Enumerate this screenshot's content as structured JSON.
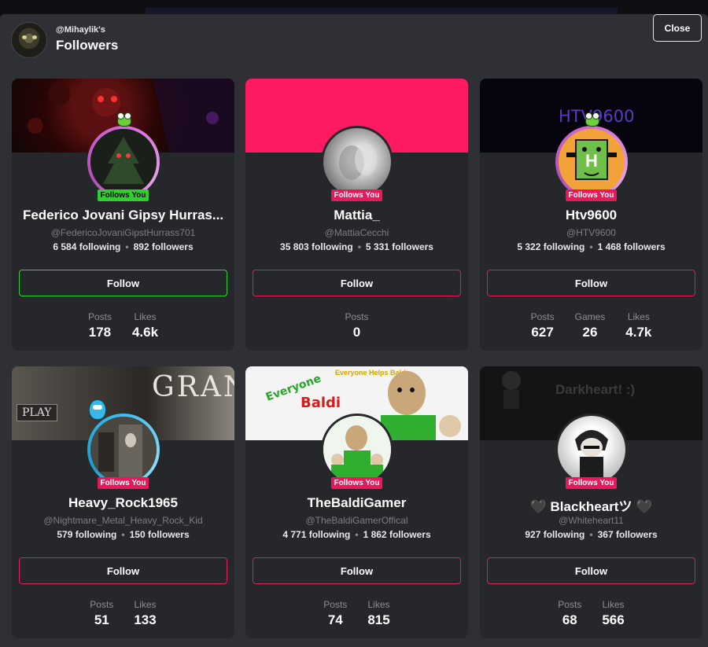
{
  "header": {
    "owner": "@Mihaylik's",
    "title": "Followers",
    "close_label": "Close"
  },
  "follow_label": "Follow",
  "follows_you_label": "Follows You",
  "colors": {
    "accent_pink": "#e8185a",
    "accent_green": "#2fd12f",
    "panel": "#2e3035",
    "card": "#25272b"
  },
  "cards": [
    {
      "name": "Federico Jovani Gipsy Hurras...",
      "handle": "@FedericoJovaniGipstHurrass701",
      "following": "6 584 following",
      "followers": "892 followers",
      "button_style": "green",
      "badge_style": "green",
      "stats": [
        {
          "label": "Posts",
          "value": "178"
        },
        {
          "label": "Likes",
          "value": "4.6k"
        }
      ]
    },
    {
      "name": "Mattia_",
      "handle": "@MattiaCecchi",
      "following": "35 803 following",
      "followers": "5 331 followers",
      "button_style": "pink",
      "badge_style": "pink",
      "stats": [
        {
          "label": "Posts",
          "value": "0"
        }
      ]
    },
    {
      "name": "Htv9600",
      "handle": "@HTV9600",
      "banner_text": "HTV9600",
      "following": "5 322 following",
      "followers": "1 468 followers",
      "button_style": "pink",
      "badge_style": "pink",
      "stats": [
        {
          "label": "Posts",
          "value": "627"
        },
        {
          "label": "Games",
          "value": "26"
        },
        {
          "label": "Likes",
          "value": "4.7k"
        }
      ]
    },
    {
      "name": "Heavy_Rock1965",
      "handle": "@Nightmare_Metal_Heavy_Rock_Kid",
      "banner_text_1": "PLAY",
      "banner_text_2": "GRANN",
      "following": "579 following",
      "followers": "150 followers",
      "button_style": "pink",
      "badge_style": "pink",
      "stats": [
        {
          "label": "Posts",
          "value": "51"
        },
        {
          "label": "Likes",
          "value": "133"
        }
      ]
    },
    {
      "name": "TheBaldiGamer",
      "handle": "@TheBaldiGamerOffical",
      "banner_text_1": "Everyone Helps Baldi",
      "banner_text_2": "Baldi",
      "following": "4 771 following",
      "followers": "1 862 followers",
      "button_style": "pink",
      "badge_style": "pink",
      "stats": [
        {
          "label": "Posts",
          "value": "74"
        },
        {
          "label": "Likes",
          "value": "815"
        }
      ]
    },
    {
      "name": "🖤 Blackheartツ 🖤",
      "handle": "@Whiteheart11",
      "banner_text_1": "Darkheart! :)",
      "following": "927 following",
      "followers": "367 followers",
      "button_style": "pink",
      "badge_style": "pink",
      "stats": [
        {
          "label": "Posts",
          "value": "68"
        },
        {
          "label": "Likes",
          "value": "566"
        }
      ]
    }
  ]
}
